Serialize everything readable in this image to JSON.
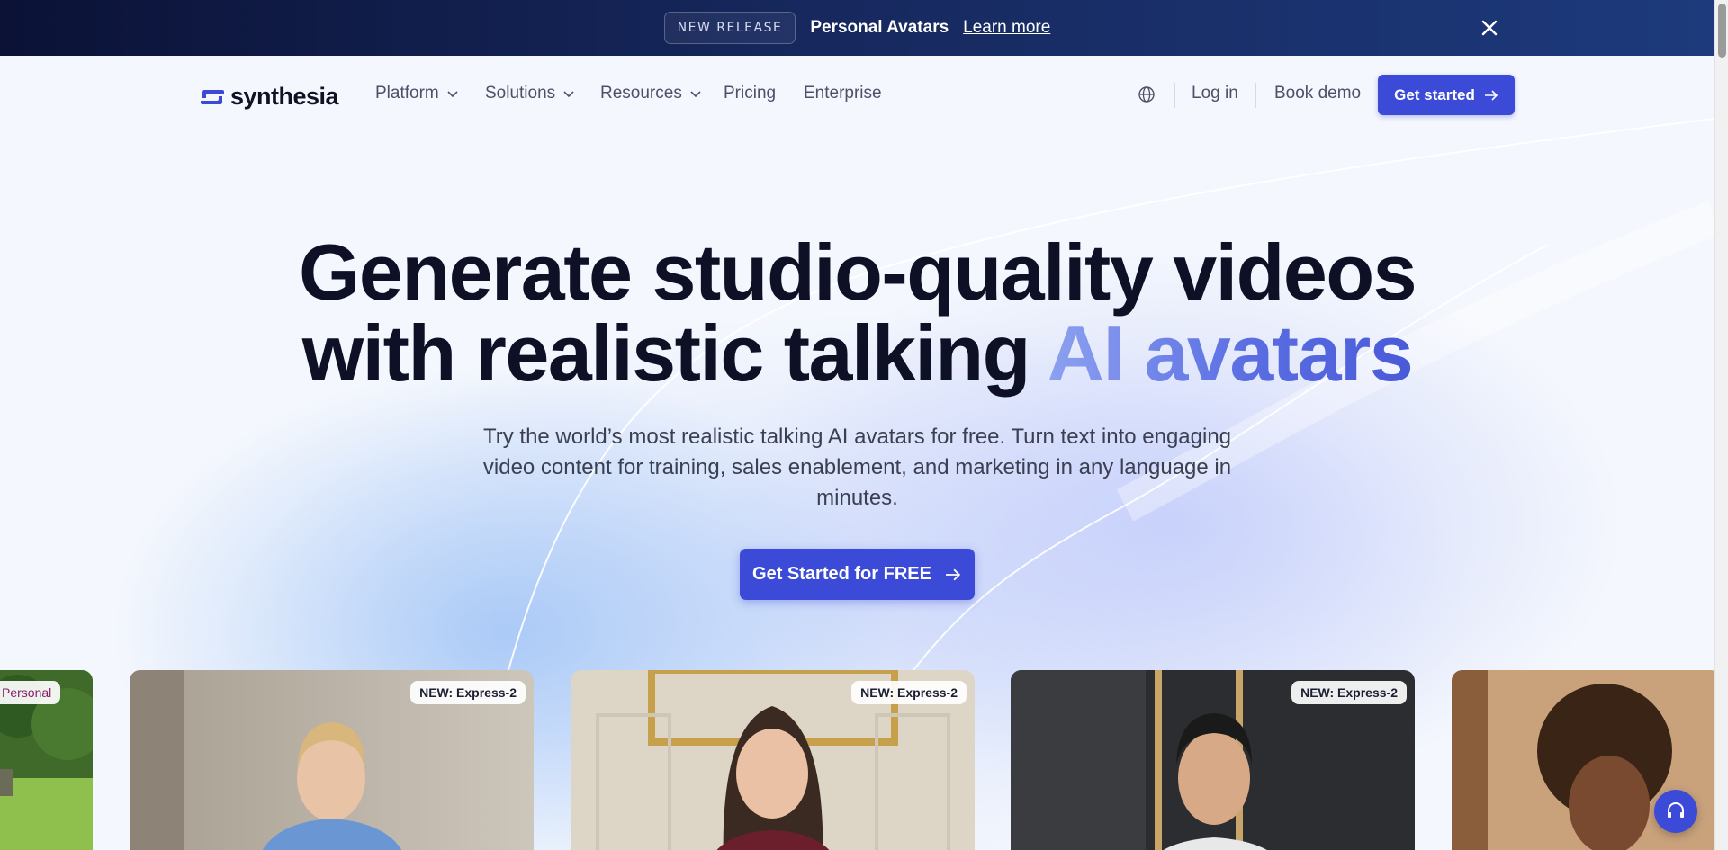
{
  "announcement": {
    "tag": "NEW RELEASE",
    "title": "Personal Avatars",
    "link": "Learn more"
  },
  "brand": {
    "name": "synthesia",
    "accent": "#3b4bd8"
  },
  "nav": {
    "items": [
      {
        "label": "Platform",
        "dropdown": true
      },
      {
        "label": "Solutions",
        "dropdown": true
      },
      {
        "label": "Resources",
        "dropdown": true
      },
      {
        "label": "Pricing",
        "dropdown": false
      },
      {
        "label": "Enterprise",
        "dropdown": false
      }
    ],
    "login": "Log in",
    "book_demo": "Book demo",
    "get_started": "Get started"
  },
  "hero": {
    "headline_line1": "Generate studio-quality videos",
    "headline_line2_plain": "with realistic talking ",
    "headline_line2_accent": "AI avatars",
    "subtext": "Try the world’s most realistic talking AI avatars for free. Turn text into engaging video content for training, sales enablement, and marketing in any language in minutes.",
    "cta": "Get Started for FREE"
  },
  "cards": [
    {
      "badge": "Personal"
    },
    {
      "badge": "NEW: Express-2"
    },
    {
      "badge": "NEW: Express-2"
    },
    {
      "badge": "NEW: Express-2"
    },
    {
      "badge": ""
    }
  ]
}
